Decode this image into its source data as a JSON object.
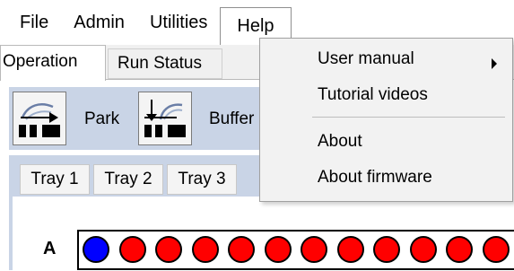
{
  "menubar": {
    "items": [
      {
        "label": "File"
      },
      {
        "label": "Admin"
      },
      {
        "label": "Utilities"
      },
      {
        "label": "Help"
      }
    ]
  },
  "tabs": [
    {
      "label": "Operation",
      "selected": true
    },
    {
      "label": "Run Status",
      "selected": false
    }
  ],
  "toolbar": {
    "park_label": "Park",
    "park_icon": "park-icon",
    "buffer_label": "Buffer",
    "buffer_icon": "buffer-icon"
  },
  "trays": [
    {
      "label": "Tray 1"
    },
    {
      "label": "Tray 2"
    },
    {
      "label": "Tray 3"
    }
  ],
  "tray_grid": {
    "row_label": "A",
    "wells": [
      "blue",
      "red",
      "red",
      "red",
      "red",
      "red",
      "red",
      "red",
      "red",
      "red",
      "red",
      "red"
    ]
  },
  "help_menu": {
    "items": [
      {
        "label": "User manual",
        "submenu": true
      },
      {
        "label": "Tutorial videos",
        "submenu": false
      },
      {
        "label": "About",
        "submenu": false
      },
      {
        "label": "About firmware",
        "submenu": false
      }
    ]
  },
  "colors": {
    "well_blue": "#0000ff",
    "well_red": "#ff0000",
    "toolbar_bg": "#c9d4e6"
  }
}
